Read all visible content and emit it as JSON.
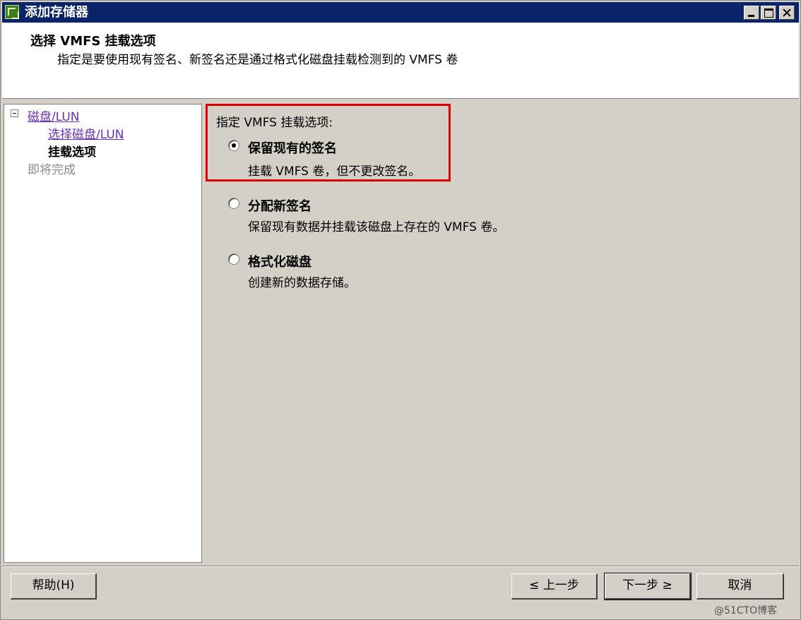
{
  "window": {
    "title": "添加存储器"
  },
  "header": {
    "title": "选择 VMFS 挂载选项",
    "subtitle": "指定是要使用现有签名、新签名还是通过格式化磁盘挂载检测到的 VMFS 卷"
  },
  "nav": {
    "items": [
      {
        "label": "磁盘/LUN",
        "state": "link"
      },
      {
        "label": "选择磁盘/LUN",
        "state": "link"
      },
      {
        "label": "挂载选项",
        "state": "current"
      },
      {
        "label": "即将完成",
        "state": "disabled"
      }
    ]
  },
  "content": {
    "options_label": "指定 VMFS 挂载选项:",
    "options": [
      {
        "title": "保留现有的签名",
        "desc": "挂载 VMFS 卷，但不更改签名。",
        "selected": true
      },
      {
        "title": "分配新签名",
        "desc": "保留现有数据并挂载该磁盘上存在的 VMFS 卷。",
        "selected": false
      },
      {
        "title": "格式化磁盘",
        "desc": "创建新的数据存储。",
        "selected": false
      }
    ]
  },
  "buttons": {
    "help": "帮助(H)",
    "back": "≤ 上一步",
    "next": "下一步 ≥",
    "cancel": "取消"
  },
  "watermark": "@51CTO博客",
  "colors": {
    "titlebar": "#0a246a",
    "highlight_border": "#e00000",
    "link": "#6b2fbd"
  }
}
